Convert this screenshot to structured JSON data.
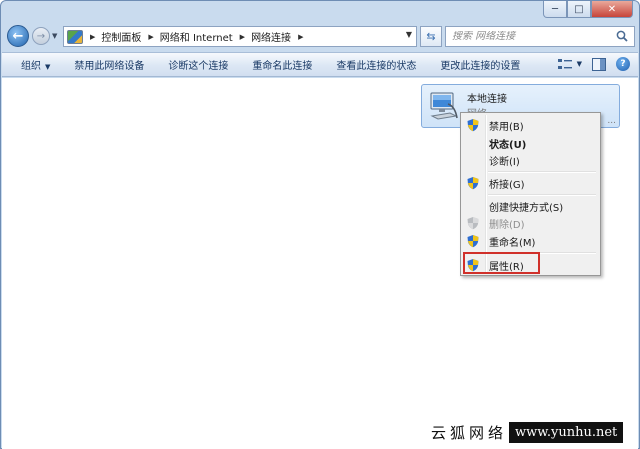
{
  "window": {
    "min_glyph": "─",
    "max_glyph": "□",
    "close_glyph": "✕"
  },
  "nav": {
    "back_glyph": "←",
    "forward_glyph": "→",
    "history_glyph": "▼"
  },
  "address": {
    "breadcrumbs": [
      "控制面板",
      "网络和 Internet",
      "网络连接"
    ],
    "separator": "▶",
    "dropdown_glyph": "▼",
    "refresh_glyph": "⇆"
  },
  "search": {
    "placeholder": "搜索 网络连接"
  },
  "toolbar": {
    "organize_label": "组织",
    "organize_arrow": "▼",
    "disable_label": "禁用此网络设备",
    "diagnose_label": "诊断这个连接",
    "rename_label": "重命名此连接",
    "status_label": "查看此连接的状态",
    "settings_label": "更改此连接的设置",
    "view_arrow": "▼",
    "help_glyph": "?"
  },
  "connection": {
    "name": "本地连接",
    "type": "网络",
    "truncated": "..."
  },
  "context_menu": {
    "items": [
      {
        "label": "禁用(B)",
        "icon": "shield-icon",
        "bold": false,
        "disabled": false
      },
      {
        "label": "状态(U)",
        "icon": "",
        "bold": true,
        "disabled": false
      },
      {
        "label": "诊断(I)",
        "icon": "",
        "bold": false,
        "disabled": false
      },
      {
        "label": "桥接(G)",
        "icon": "shield-icon",
        "bold": false,
        "disabled": false
      },
      {
        "label": "创建快捷方式(S)",
        "icon": "",
        "bold": false,
        "disabled": false
      },
      {
        "label": "删除(D)",
        "icon": "shield-icon",
        "bold": false,
        "disabled": true
      },
      {
        "label": "重命名(M)",
        "icon": "shield-icon",
        "bold": false,
        "disabled": false
      },
      {
        "label": "属性(R)",
        "icon": "shield-icon",
        "bold": false,
        "disabled": false
      }
    ]
  },
  "watermark": {
    "text_cn": "云狐网络",
    "url": "www.yunhu.net"
  },
  "colors": {
    "highlight_border": "#d0302a",
    "frame": "#c9dbee",
    "command_text": "#1a3a66"
  }
}
